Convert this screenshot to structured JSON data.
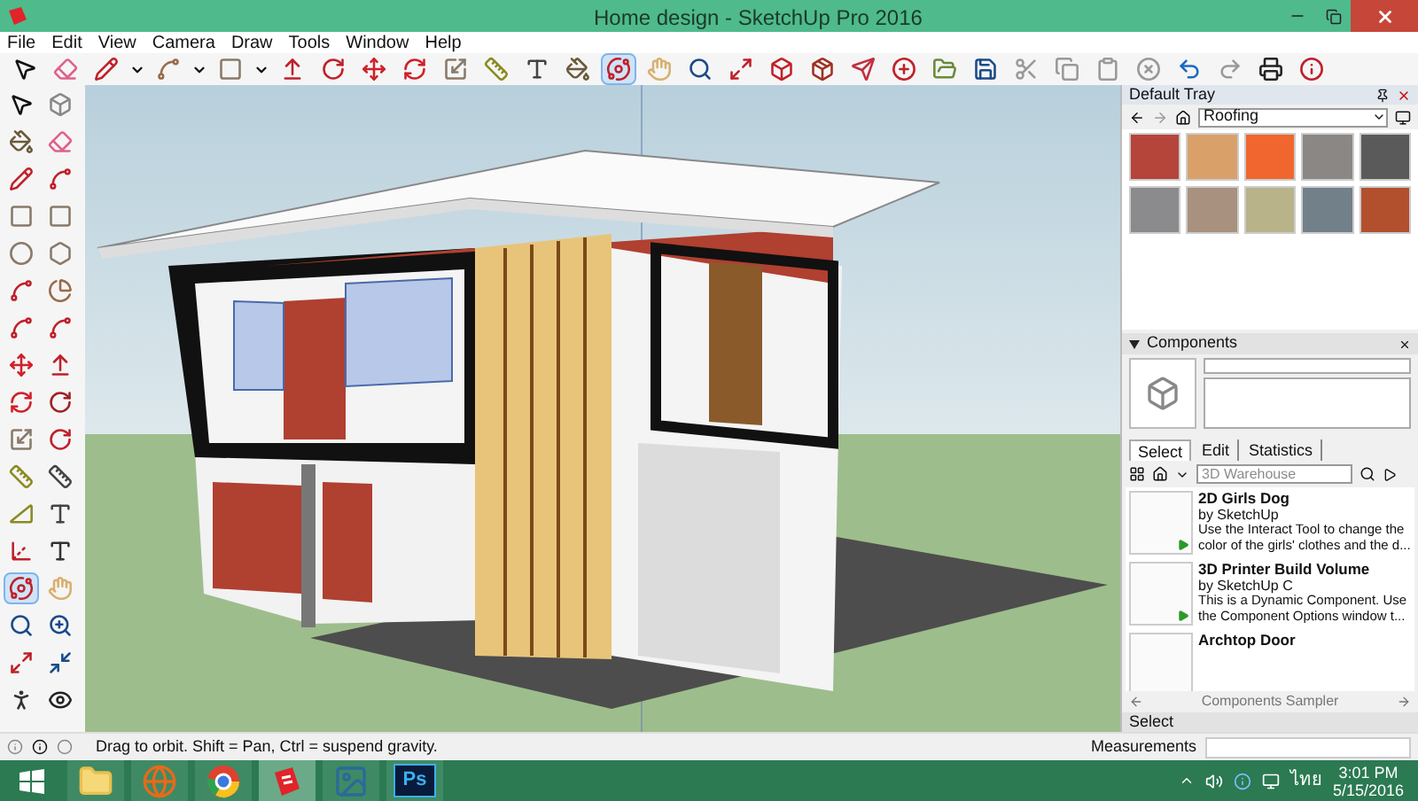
{
  "window": {
    "title": "Home design - SketchUp Pro 2016"
  },
  "menu": [
    "File",
    "Edit",
    "View",
    "Camera",
    "Draw",
    "Tools",
    "Window",
    "Help"
  ],
  "toolbar": {
    "buttons": [
      {
        "selected": false
      },
      {
        "selected": false
      },
      {
        "selected": false
      },
      {
        "selected": false
      },
      {
        "selected": false
      },
      {
        "selected": false
      },
      {
        "selected": false
      },
      {
        "selected": false
      },
      {
        "selected": false
      },
      {
        "selected": false
      },
      {
        "selected": false
      },
      {
        "selected": false
      },
      {
        "selected": false
      },
      {
        "selected": true
      },
      {
        "selected": false
      },
      {
        "selected": false
      },
      {
        "selected": false
      },
      {
        "selected": false
      },
      {
        "selected": false
      },
      {
        "selected": false
      },
      {
        "selected": false
      },
      {
        "selected": false
      },
      {
        "selected": false
      },
      {
        "selected": false
      },
      {
        "selected": false
      },
      {
        "selected": false
      },
      {
        "selected": false
      },
      {
        "selected": false
      },
      {
        "selected": false
      },
      {
        "selected": false
      },
      {
        "selected": false
      }
    ]
  },
  "tool_palette": {
    "buttons": [
      {
        "selected": false
      },
      {
        "selected": false
      },
      {
        "selected": false
      },
      {
        "selected": false
      },
      {
        "selected": false
      },
      {
        "selected": false
      },
      {
        "selected": false
      },
      {
        "selected": false
      },
      {
        "selected": false
      },
      {
        "selected": false
      },
      {
        "selected": false
      },
      {
        "selected": false
      },
      {
        "selected": false
      },
      {
        "selected": false
      },
      {
        "selected": false
      },
      {
        "selected": false
      },
      {
        "selected": false
      },
      {
        "selected": false
      },
      {
        "selected": false
      },
      {
        "selected": false
      },
      {
        "selected": false
      },
      {
        "selected": false
      },
      {
        "selected": false
      },
      {
        "selected": false
      },
      {
        "selected": false
      },
      {
        "selected": false
      },
      {
        "selected": true
      },
      {
        "selected": false
      },
      {
        "selected": false
      },
      {
        "selected": false
      },
      {
        "selected": false
      },
      {
        "selected": false
      },
      {
        "selected": false
      },
      {
        "selected": false
      }
    ]
  },
  "tray": {
    "title": "Default Tray",
    "materials": {
      "library": "Roofing",
      "swatches": [
        {
          "color": "#b5443a"
        },
        {
          "color": "#d9a06a"
        },
        {
          "color": "#f0662e"
        },
        {
          "color": "#8a8784"
        },
        {
          "color": "#5a5a5a"
        },
        {
          "color": "#8b8a8c"
        },
        {
          "color": "#a8917e"
        },
        {
          "color": "#b9b38a"
        },
        {
          "color": "#72808a"
        },
        {
          "color": "#b2502e"
        }
      ]
    },
    "components": {
      "title": "Components",
      "tabs": [
        {
          "label": "Select",
          "selected": true
        },
        {
          "label": "Edit",
          "selected": false
        },
        {
          "label": "Statistics",
          "selected": false
        }
      ],
      "search": {
        "placeholder": "3D Warehouse"
      },
      "items": [
        {
          "title": "2D Girls Dog",
          "author": "by SketchUp",
          "description": "Use the Interact Tool to change the color of the girls' clothes and the d...",
          "dynamic": true
        },
        {
          "title": "3D Printer Build Volume",
          "author": "by SketchUp C",
          "description": "This is a Dynamic Component. Use the Component Options window t...",
          "dynamic": true
        },
        {
          "title": "Archtop Door",
          "dynamic": false
        }
      ],
      "collection": "Components Sampler"
    },
    "collapsed_panel": "Select"
  },
  "status_bar": {
    "hint": "Drag to orbit. Shift = Pan, Ctrl = suspend gravity.",
    "measurements_label": "Measurements"
  },
  "taskbar": {
    "apps": [
      {
        "kind": "explorer",
        "selected": false
      },
      {
        "kind": "firefox",
        "selected": false
      },
      {
        "kind": "chrome",
        "selected": false
      },
      {
        "kind": "sketchup",
        "selected": true
      },
      {
        "kind": "photos",
        "selected": false
      },
      {
        "kind": "photoshop",
        "label": "Ps",
        "selected": false
      }
    ],
    "language": "ไทย",
    "time": "3:01 PM",
    "date": "5/15/2016"
  }
}
